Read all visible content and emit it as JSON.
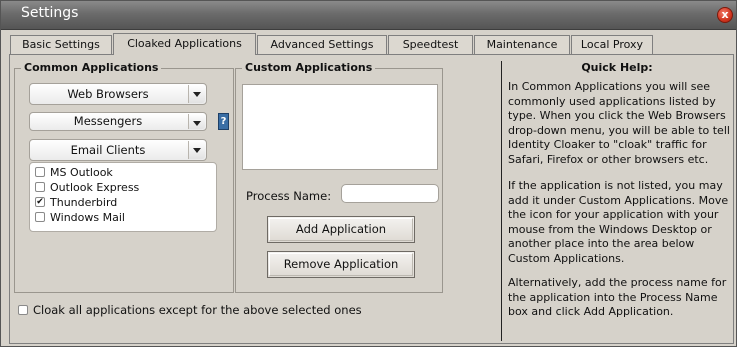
{
  "window": {
    "title": "Settings",
    "close_label": "x"
  },
  "tabs": [
    {
      "label": "Basic Settings"
    },
    {
      "label": "Cloaked Applications"
    },
    {
      "label": "Advanced Settings"
    },
    {
      "label": "Speedtest"
    },
    {
      "label": "Maintenance"
    },
    {
      "label": "Local Proxy"
    }
  ],
  "active_tab": "Cloaked Applications",
  "common_apps": {
    "legend": "Common Applications",
    "dropdowns": [
      {
        "label": "Web Browsers"
      },
      {
        "label": "Messengers"
      },
      {
        "label": "Email Clients"
      }
    ],
    "help_label": "?",
    "items": [
      {
        "label": "MS Outlook",
        "checked": false
      },
      {
        "label": "Outlook Express",
        "checked": false
      },
      {
        "label": "Thunderbird",
        "checked": true
      },
      {
        "label": "Windows Mail",
        "checked": false
      }
    ]
  },
  "custom_apps": {
    "legend": "Custom Applications",
    "process_label": "Process Name:",
    "process_value": "",
    "add_button": "Add Application",
    "remove_button": "Remove Application"
  },
  "cloak_all": {
    "label": "Cloak all applications except for the above selected ones",
    "checked": false
  },
  "quick_help": {
    "title": "Quick Help:",
    "paragraphs": [
      "In Common Applications you will see commonly used applications listed by type. When you click the Web Browsers drop-down menu, you will be able to tell Identity Cloaker to \"cloak\" traffic for Safari, Firefox or other browsers etc.",
      "If the application is not listed, you may add it under Custom Applications. Move the icon for your application with your mouse from the Windows Desktop or another place into the area below Custom Applications.",
      "Alternatively, add the process name for the application into the Process Name box and click Add Application."
    ]
  },
  "colors": {
    "titlebar": "#6b6b6b",
    "panel": "#d6d2ca",
    "close": "#d0351f"
  }
}
